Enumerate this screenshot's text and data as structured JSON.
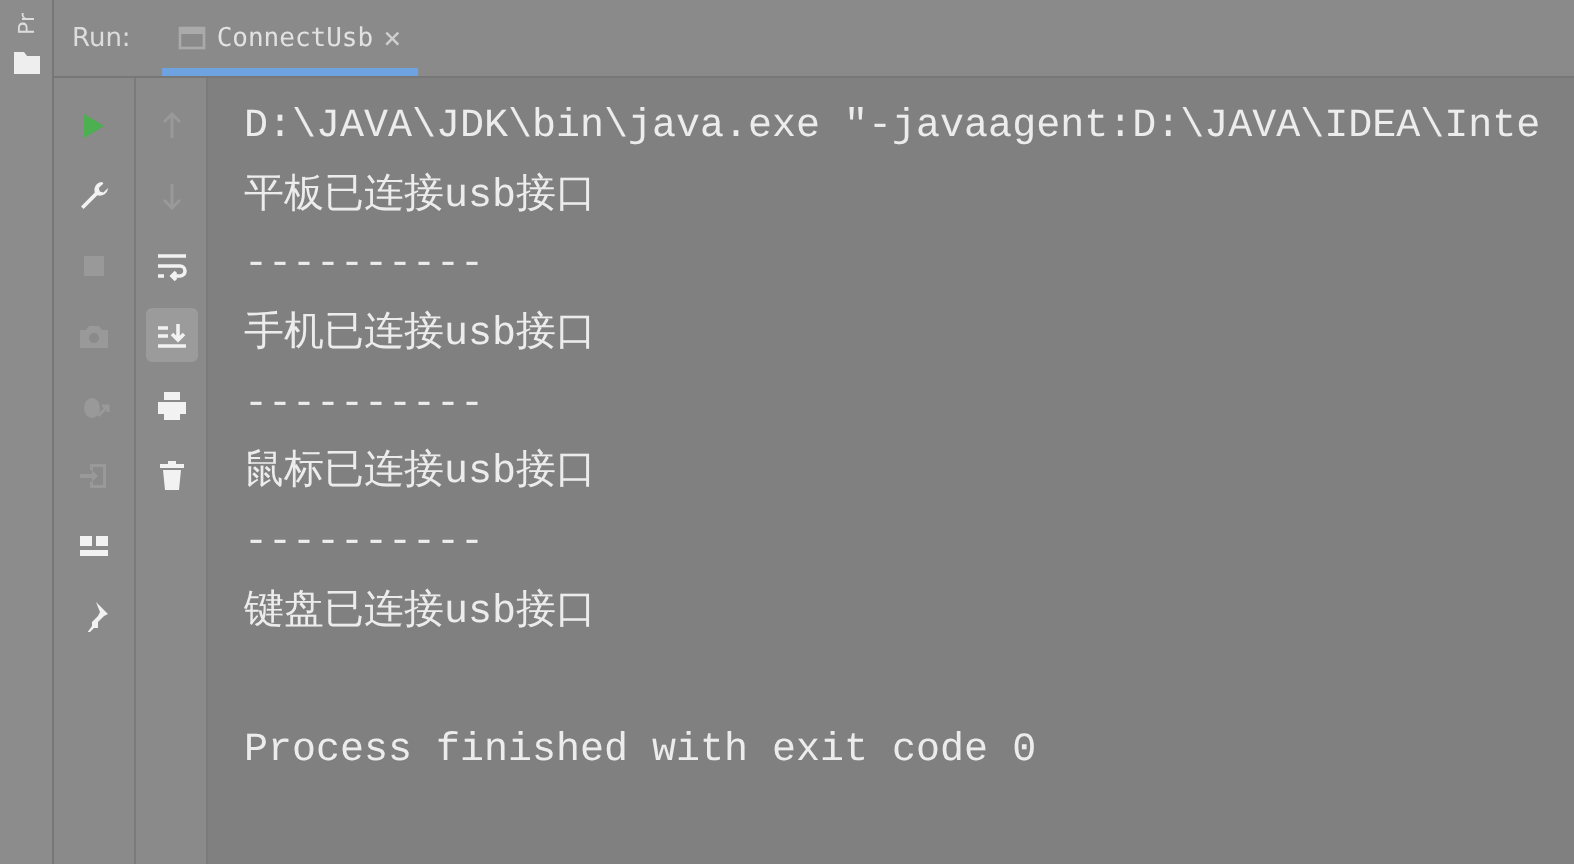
{
  "side_strip": {
    "label": "Pr"
  },
  "run_panel": {
    "title": "Run:",
    "tabs": [
      {
        "label": "ConnectUsb",
        "close": "×",
        "selected": true
      }
    ]
  },
  "toolbar_main": [
    {
      "disabled": false
    },
    {
      "disabled": false
    },
    {
      "disabled": true
    },
    {
      "disabled": true
    },
    {
      "disabled": true
    },
    {
      "disabled": true
    },
    {
      "disabled": false
    },
    {
      "disabled": false
    }
  ],
  "toolbar_side": [
    {
      "disabled": true,
      "selected": false
    },
    {
      "disabled": true,
      "selected": false
    },
    {
      "disabled": false,
      "selected": false
    },
    {
      "disabled": false,
      "selected": true
    },
    {
      "disabled": false,
      "selected": false
    },
    {
      "disabled": false,
      "selected": false
    }
  ],
  "console_blocks": [
    {
      "lines": [
        "D:\\JAVA\\JDK\\bin\\java.exe \"-javaagent:D:\\JAVA\\IDEA\\Inte",
        "平板已连接usb接口",
        "----------",
        "手机已连接usb接口",
        "----------",
        "鼠标已连接usb接口",
        "----------",
        "键盘已连接usb接口"
      ]
    },
    {
      "lines": [
        "Process finished with exit code 0"
      ]
    }
  ]
}
